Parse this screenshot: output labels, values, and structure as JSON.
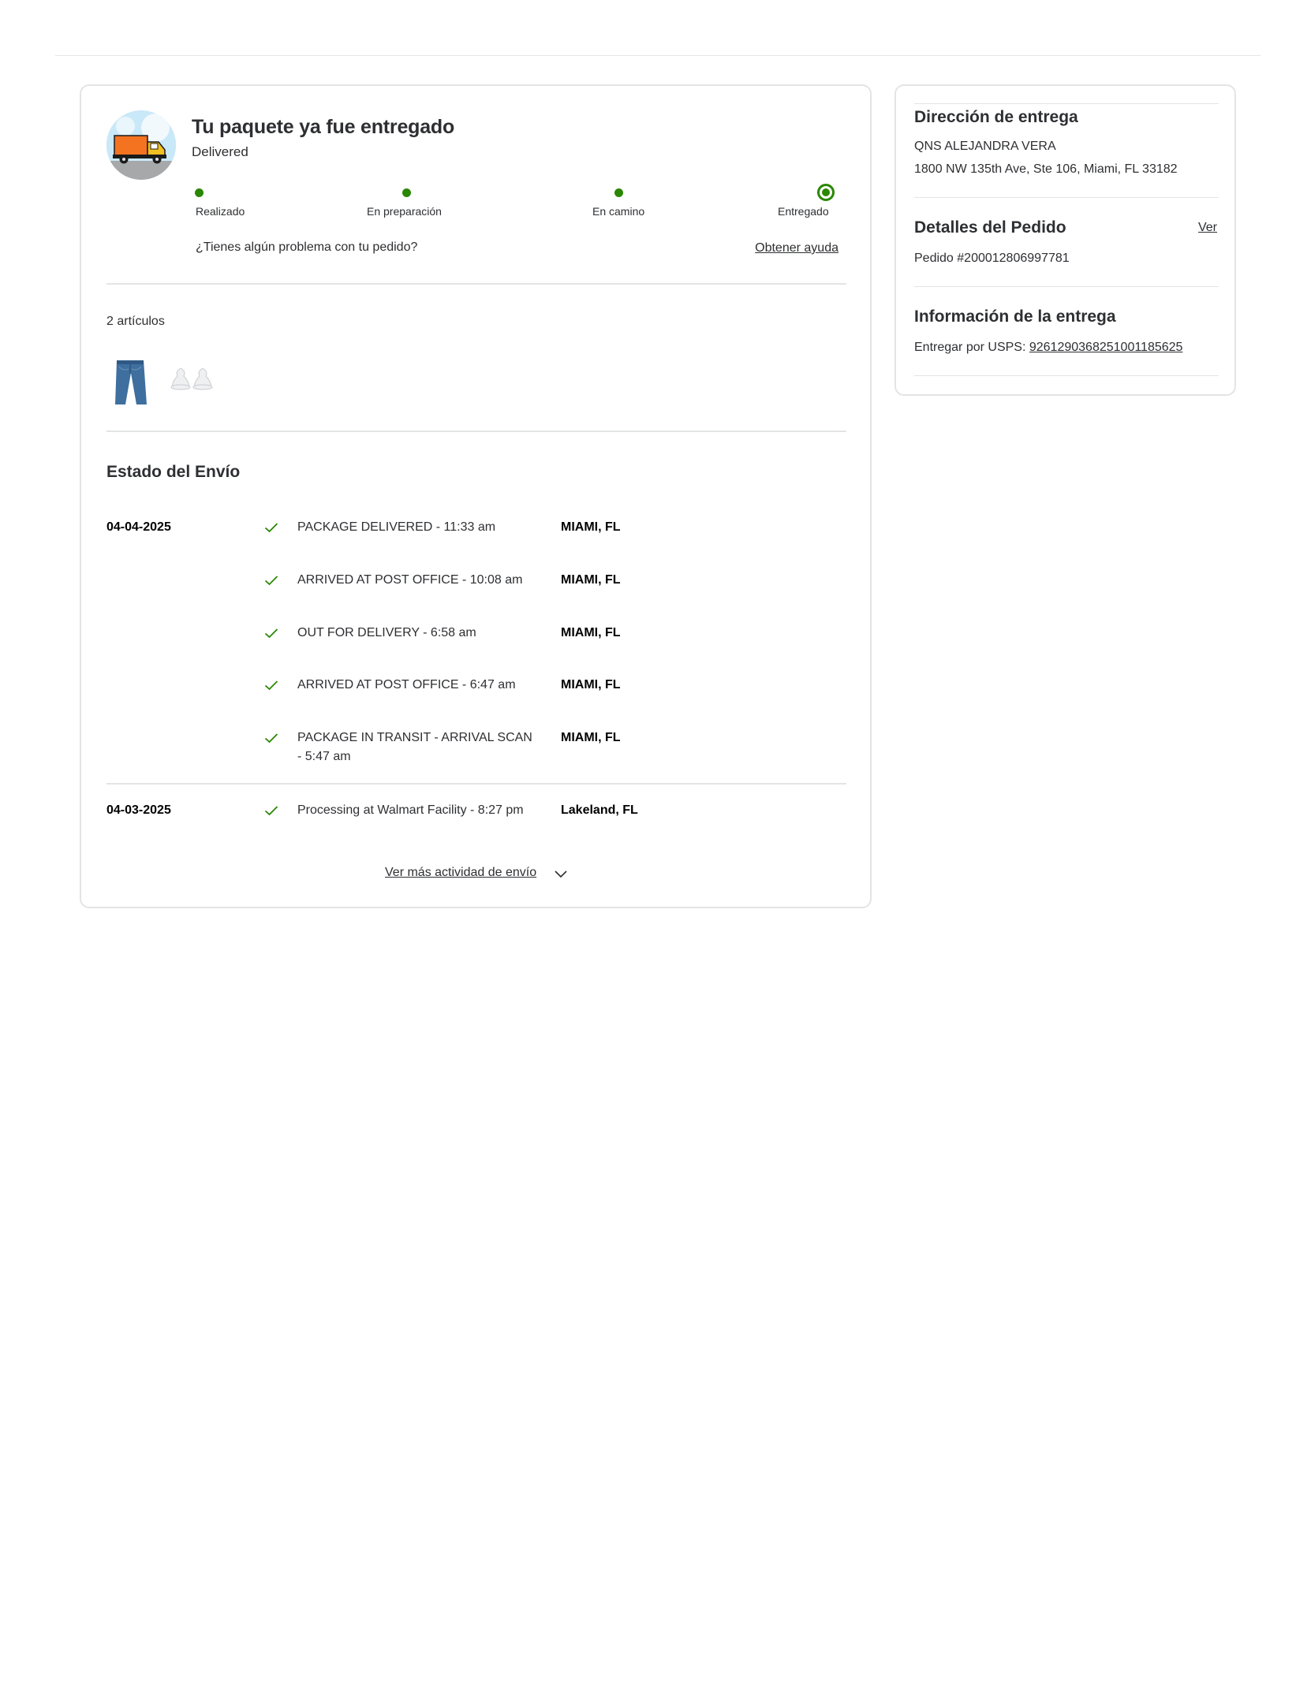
{
  "status": {
    "title": "Tu paquete ya fue entregado",
    "subtitle": "Delivered",
    "steps": [
      {
        "label": "Realizado",
        "complete": true
      },
      {
        "label": "En preparación",
        "complete": true
      },
      {
        "label": "En camino",
        "complete": true
      },
      {
        "label": "Entregado",
        "complete": true,
        "current": true
      }
    ],
    "help_question": "¿Tienes algún problema con tu pedido?",
    "help_link": "Obtener ayuda"
  },
  "items": {
    "count_label": "2 artículos",
    "thumbnails": [
      {
        "icon": "jeans-image"
      },
      {
        "icon": "bottle-nipples-image"
      }
    ]
  },
  "shipment": {
    "title": "Estado del Envío",
    "events": [
      {
        "date": "04-04-2025",
        "event": "PACKAGE DELIVERED - 11:33 am",
        "location": "MIAMI, FL"
      },
      {
        "date": "",
        "event": "ARRIVED AT POST OFFICE - 10:08 am",
        "location": "MIAMI, FL"
      },
      {
        "date": "",
        "event": "OUT FOR DELIVERY - 6:58 am",
        "location": "MIAMI, FL"
      },
      {
        "date": "",
        "event": "ARRIVED AT POST OFFICE - 6:47 am",
        "location": "MIAMI, FL"
      },
      {
        "date": "",
        "event": "PACKAGE IN TRANSIT - ARRIVAL SCAN - 5:47 am",
        "location": "MIAMI, FL"
      },
      {
        "date": "04-03-2025",
        "event": "Processing at Walmart Facility - 8:27 pm",
        "location": "Lakeland, FL"
      }
    ],
    "more_link": "Ver más actividad de envío"
  },
  "sidebar": {
    "address": {
      "title": "Dirección de entrega",
      "name": "QNS ALEJANDRA VERA",
      "line": "1800 NW 135th Ave, Ste 106, Miami, FL 33182"
    },
    "order": {
      "title": "Detalles del Pedido",
      "view_link": "Ver",
      "number": "Pedido #200012806997781"
    },
    "delivery": {
      "title": "Información de la entrega",
      "carrier_prefix": "Entregar por USPS:",
      "tracking": "9261290368251001185625"
    }
  },
  "colors": {
    "success_green": "#2a8703",
    "text": "#2e2f32",
    "border": "#e3e4e5"
  }
}
